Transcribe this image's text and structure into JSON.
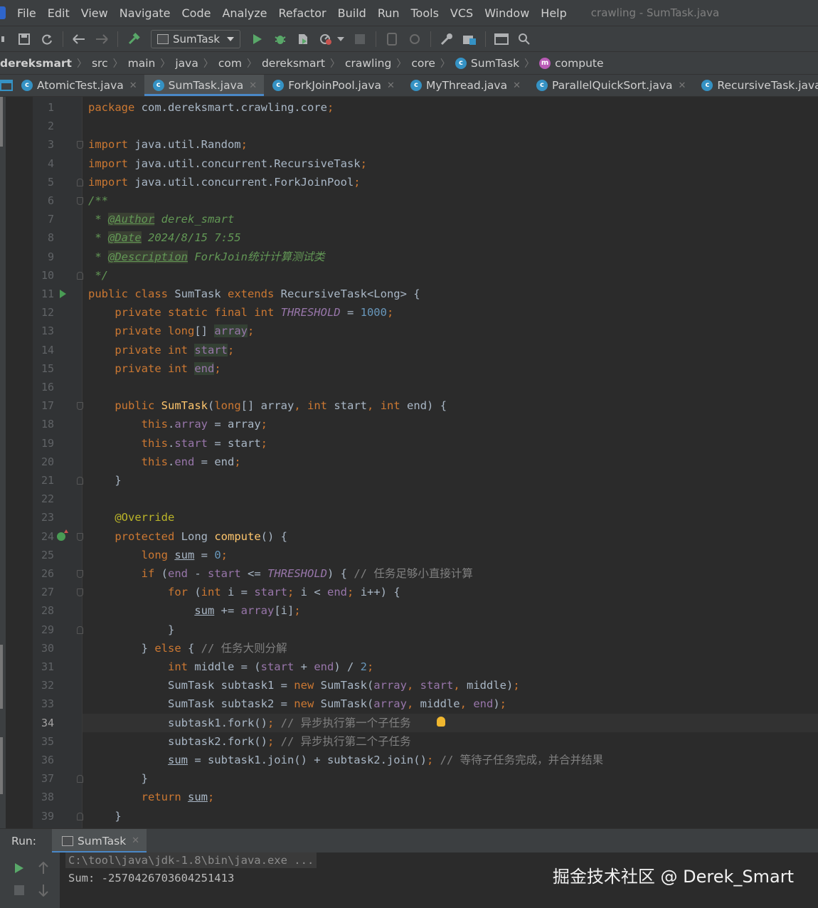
{
  "menu": {
    "items": [
      "File",
      "Edit",
      "View",
      "Navigate",
      "Code",
      "Analyze",
      "Refactor",
      "Build",
      "Run",
      "Tools",
      "VCS",
      "Window",
      "Help"
    ],
    "window_title": "crawling - SumTask.java"
  },
  "toolbar": {
    "run_config": "SumTask",
    "icons": [
      "save-icon",
      "sync-icon",
      "back-icon",
      "forward-icon",
      "build-hammer-icon",
      "run-icon",
      "debug-icon",
      "coverage-icon",
      "profile-icon",
      "stop-icon",
      "device-icon",
      "wrench-icon",
      "project-structure-icon",
      "frame-icon",
      "search-icon"
    ]
  },
  "breadcrumb": [
    "dereksmart",
    "src",
    "main",
    "java",
    "com",
    "dereksmart",
    "crawling",
    "core",
    "SumTask",
    "compute"
  ],
  "tabs": [
    {
      "label": "AtomicTest.java",
      "active": false
    },
    {
      "label": "SumTask.java",
      "active": true
    },
    {
      "label": "ForkJoinPool.java",
      "active": false
    },
    {
      "label": "MyThread.java",
      "active": false
    },
    {
      "label": "ParallelQuickSort.java",
      "active": false
    },
    {
      "label": "RecursiveTask.java",
      "active": false
    }
  ],
  "editor": {
    "current_line": 34,
    "lines": [
      {
        "n": 1,
        "html": "<span class=\"kw\">package</span> com.dereksmart.crawling.core<span class=\"kw\">;</span>"
      },
      {
        "n": 2,
        "html": ""
      },
      {
        "n": 3,
        "html": "<span class=\"kw\">import</span> java.util.Random<span class=\"kw\">;</span>"
      },
      {
        "n": 4,
        "html": "<span class=\"kw\">import</span> java.util.concurrent.RecursiveTask<span class=\"kw\">;</span>"
      },
      {
        "n": 5,
        "html": "<span class=\"kw\">import</span> java.util.concurrent.ForkJoinPool<span class=\"kw\">;</span>"
      },
      {
        "n": 6,
        "html": "<span class=\"cm\">/**</span>"
      },
      {
        "n": 7,
        "html": "<span class=\"cm\"> * </span><span class=\"tag\">@Author</span><span class=\"cm\"> derek_smart</span>"
      },
      {
        "n": 8,
        "html": "<span class=\"cm\"> * </span><span class=\"tag\">@Date</span><span class=\"cm\"> 2024/8/15 7:55</span>"
      },
      {
        "n": 9,
        "html": "<span class=\"cm\"> * </span><span class=\"tag\">@Description</span><span class=\"cm\"> ForkJoin<span class=\"cjk\">统计计算测试类</span></span>"
      },
      {
        "n": 10,
        "html": "<span class=\"cm\"> */</span>"
      },
      {
        "n": 11,
        "html": "<span class=\"kw\">public class</span> SumTask <span class=\"kw\">extends</span> RecursiveTask&lt;Long&gt; {"
      },
      {
        "n": 12,
        "html": "    <span class=\"kw\">private static final int</span> <span class=\"cst\">THRESHOLD</span> = <span class=\"num\">1000</span><span class=\"kw\">;</span>"
      },
      {
        "n": 13,
        "html": "    <span class=\"kw\">private</span> <span class=\"kw\">long</span>[] <span class=\"fld hl\">array</span><span class=\"kw\">;</span>"
      },
      {
        "n": 14,
        "html": "    <span class=\"kw\">private int</span> <span class=\"fld hl\">start</span><span class=\"kw\">;</span>"
      },
      {
        "n": 15,
        "html": "    <span class=\"kw\">private int</span> <span class=\"fld hl\">end</span><span class=\"kw\">;</span>"
      },
      {
        "n": 16,
        "html": ""
      },
      {
        "n": 17,
        "html": "    <span class=\"kw\">public</span> <span class=\"fn\">SumTask</span>(<span class=\"kw\">long</span>[] array<span class=\"kw\">,</span> <span class=\"kw\">int</span> start<span class=\"kw\">,</span> <span class=\"kw\">int</span> end) {"
      },
      {
        "n": 18,
        "html": "        <span class=\"kw\">this</span>.<span class=\"fld\">array</span> = array<span class=\"kw\">;</span>"
      },
      {
        "n": 19,
        "html": "        <span class=\"kw\">this</span>.<span class=\"fld\">start</span> = start<span class=\"kw\">;</span>"
      },
      {
        "n": 20,
        "html": "        <span class=\"kw\">this</span>.<span class=\"fld\">end</span> = end<span class=\"kw\">;</span>"
      },
      {
        "n": 21,
        "html": "    }"
      },
      {
        "n": 22,
        "html": ""
      },
      {
        "n": 23,
        "html": "    <span class=\"an\">@Override</span>"
      },
      {
        "n": 24,
        "html": "    <span class=\"kw\">protected</span> Long <span class=\"fn\">compute</span>() {"
      },
      {
        "n": 25,
        "html": "        <span class=\"kw\">long</span> <span class=\"ul\">sum</span> = <span class=\"num\">0</span><span class=\"kw\">;</span>"
      },
      {
        "n": 26,
        "html": "        <span class=\"kw\">if</span> (<span class=\"fld\">end</span> - <span class=\"fld\">start</span> &lt;= <span class=\"cst\">THRESHOLD</span>) { <span class=\"lc\">// <span class=\"cjk\">任务足够小直接计算</span></span>"
      },
      {
        "n": 27,
        "html": "            <span class=\"kw\">for</span> (<span class=\"kw\">int</span> i = <span class=\"fld\">start</span><span class=\"kw\">;</span> i &lt; <span class=\"fld\">end</span><span class=\"kw\">;</span> i++) {"
      },
      {
        "n": 28,
        "html": "                <span class=\"ul\">sum</span> += <span class=\"fld\">array</span>[i]<span class=\"kw\">;</span>"
      },
      {
        "n": 29,
        "html": "            }"
      },
      {
        "n": 30,
        "html": "        } <span class=\"kw\">else</span> { <span class=\"lc\">// <span class=\"cjk\">任务大则分解</span></span>"
      },
      {
        "n": 31,
        "html": "            <span class=\"kw\">int</span> middle = (<span class=\"fld\">start</span> + <span class=\"fld\">end</span>) / <span class=\"num\">2</span><span class=\"kw\">;</span>"
      },
      {
        "n": 32,
        "html": "            SumTask subtask1 = <span class=\"kw\">new</span> SumTask(<span class=\"fld\">array</span><span class=\"kw\">,</span> <span class=\"fld\">start</span><span class=\"kw\">,</span> middle)<span class=\"kw\">;</span>"
      },
      {
        "n": 33,
        "html": "            SumTask subtask2 = <span class=\"kw\">new</span> SumTask(<span class=\"fld\">array</span><span class=\"kw\">,</span> middle<span class=\"kw\">,</span> <span class=\"fld\">end</span>)<span class=\"kw\">;</span>"
      },
      {
        "n": 34,
        "html": "            subtask1.fork()<span class=\"kw\">;</span> <span class=\"lc\">// <span class=\"cjk\">异步执行第一个子任务</span></span>"
      },
      {
        "n": 35,
        "html": "            subtask2.fork()<span class=\"kw\">;</span> <span class=\"lc\">// <span class=\"cjk\">异步执行第二个子任务</span></span>"
      },
      {
        "n": 36,
        "html": "            <span class=\"ul\">sum</span> = subtask1.join() + subtask2.join()<span class=\"kw\">;</span> <span class=\"lc\">// <span class=\"cjk\">等待子任务完成，并合并结果</span></span>"
      },
      {
        "n": 37,
        "html": "        }"
      },
      {
        "n": 38,
        "html": "        <span class=\"kw\">return</span> <span class=\"ul\">sum</span><span class=\"kw\">;</span>"
      },
      {
        "n": 39,
        "html": "    }"
      }
    ]
  },
  "run_panel": {
    "label": "Run:",
    "tab": "SumTask",
    "console": [
      "C:\\tool\\java\\jdk-1.8\\bin\\java.exe ...",
      "Sum: -2570426703604251413"
    ]
  },
  "watermark": "掘金技术社区 @ Derek_Smart",
  "colors": {
    "keyword": "#cc7832",
    "comment": "#629755",
    "field": "#9876aa",
    "number": "#6897bb",
    "function": "#ffc66d",
    "annotation": "#bbb529",
    "accent": "#4a88c7"
  }
}
